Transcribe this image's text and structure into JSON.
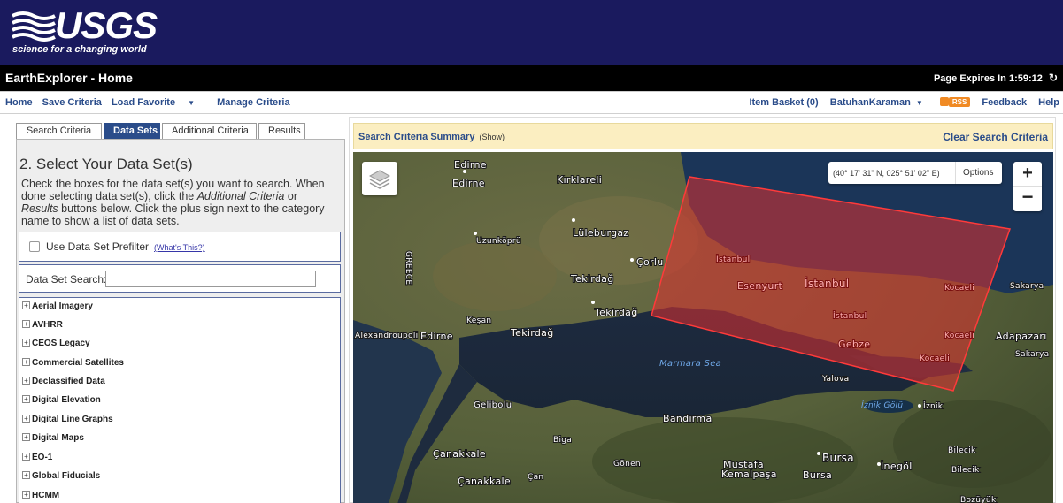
{
  "header": {
    "brand": "USGS",
    "tagline": "science for a changing world"
  },
  "title_bar": {
    "title": "EarthExplorer - Home",
    "expires": "Page Expires In 1:59:12"
  },
  "nav": {
    "left": [
      "Home",
      "Save Criteria",
      "Load Favorite",
      "Manage Criteria"
    ],
    "item_basket": "Item Basket (0)",
    "user": "BatuhanKaraman",
    "rss": "RSS",
    "feedback": "Feedback",
    "help": "Help"
  },
  "tabs": [
    "Search Criteria",
    "Data Sets",
    "Additional Criteria",
    "Results"
  ],
  "active_tab": "Data Sets",
  "datasets_panel": {
    "heading": "2. Select Your Data Set(s)",
    "instructions_part1": "Check the boxes for the data set(s) you want to search. When done selecting data set(s), click the ",
    "instructions_em1": "Additional Criteria",
    "instructions_part2": " or ",
    "instructions_em2": "Results",
    "instructions_part3": " buttons below. Click the plus sign next to the category name to show a list of data sets.",
    "prefilter_label": "Use Data Set Prefilter",
    "prefilter_link": "(What's This?)",
    "prefilter_checked": false,
    "search_label": "Data Set Search:",
    "search_value": "",
    "categories": [
      "Aerial Imagery",
      "AVHRR",
      "CEOS Legacy",
      "Commercial Satellites",
      "Declassified Data",
      "Digital Elevation",
      "Digital Line Graphs",
      "Digital Maps",
      "EO-1",
      "Global Fiducials",
      "HCMM"
    ]
  },
  "summary_bar": {
    "title": "Search Criteria Summary",
    "show": "(Show)",
    "clear": "Clear Search Criteria"
  },
  "map": {
    "coordinates": "(40° 17' 31\" N, 025° 51' 02\" E)",
    "options": "Options",
    "zoom_in": "+",
    "zoom_out": "−",
    "labels": {
      "edirne1": "Edirne",
      "edirne2": "Edirne",
      "kirklareli": "Kırklareli",
      "greece": "GREECE",
      "uzunkopru": "Uzunköprü",
      "luleburgaz": "Lüleburgaz",
      "corlu": "Çorlu",
      "tekirdag1": "Tekirdağ",
      "tekirdag2": "Tekirdağ",
      "tekirdag3": "Tekirdağ",
      "kesan": "Keşan",
      "alexandroupoli": "Alexandroupoli",
      "edirne3": "Edirne",
      "marmara": "Marmara Sea",
      "istanbul_small": "İstanbul",
      "esenyurt": "Esenyurt",
      "istanbul_big": "İstanbul",
      "istanbul3": "İstanbul",
      "kocaeli1": "Kocaeli",
      "gebze": "Gebze",
      "kocaeli2": "Kocaeli",
      "kocaeli3": "Kocaeli",
      "sakarya1": "Sakarya",
      "adapazari": "Adapazarı",
      "sakarya2": "Sakarya",
      "yalova": "Yalova",
      "iznik_golu": "İznik Gölü",
      "iznik": "İznik",
      "gelibolu": "Gelibolu",
      "bandirma": "Bandırma",
      "biga": "Biga",
      "canakkale1": "Çanakkale",
      "canakkale2": "Çanakkale",
      "can": "Çan",
      "gonen": "Gönen",
      "mustafa": "Mustafa",
      "kemalpasa": "Kemalpaşa",
      "bursa1": "Bursa",
      "bursa2": "Bursa",
      "inegol": "İnegöl",
      "bilecik1": "Bilecik",
      "bilecik2": "Bilecik",
      "bozuyuk": "Bozüyük"
    }
  },
  "colors": {
    "header_bg": "#1a1a5e",
    "title_bar_bg": "#000000",
    "accent_blue": "#2a4c8a",
    "summary_bg": "#fbeec1",
    "polygon_fill": "#e03030",
    "polygon_stroke": "#ff3a3a"
  }
}
